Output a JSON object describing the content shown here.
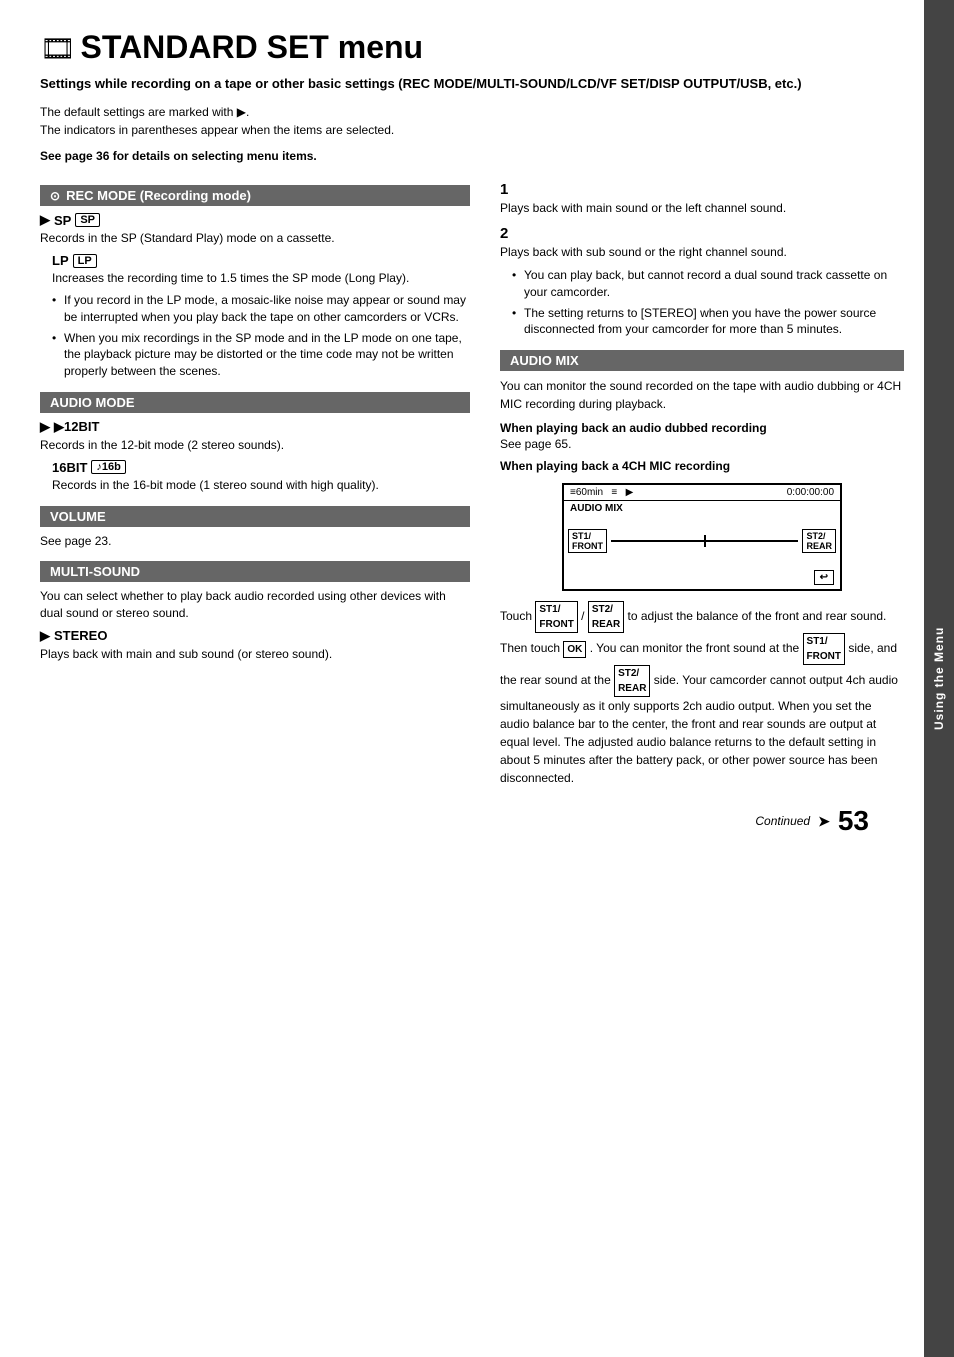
{
  "header": {
    "icon": "🎞",
    "title": "STANDARD SET menu",
    "subtitle": "Settings while recording on a tape or other basic settings (REC MODE/MULTI-SOUND/LCD/VF SET/DISP OUTPUT/USB, etc.)",
    "intro1": "The default settings are marked with ▶.",
    "intro2": "The indicators in parentheses appear when the items are selected.",
    "bold_link": "See page 36 for details on selecting menu items."
  },
  "left_column": {
    "rec_mode": {
      "header": "REC MODE (Recording mode)",
      "sp_label": "▶SP",
      "sp_badge": "SP",
      "sp_desc": "Records in the SP (Standard Play) mode on a cassette.",
      "lp_label": "LP",
      "lp_badge": "LP",
      "lp_desc": "Increases the recording time to 1.5 times the SP mode (Long Play).",
      "bullets": [
        "If you record in the LP mode, a mosaic-like noise may appear or sound may be interrupted when you play back the tape on other camcorders or VCRs.",
        "When you mix recordings in the SP mode and in the LP mode on one tape, the playback picture may be distorted or the time code may not be written properly between the scenes."
      ]
    },
    "audio_mode": {
      "header": "AUDIO MODE",
      "bit12_label": "▶12BIT",
      "bit12_desc": "Records in the 12-bit mode (2 stereo sounds).",
      "bit16_label": "16BIT",
      "bit16_badge": "♪16b",
      "bit16_desc": "Records in the 16-bit mode (1 stereo sound with high quality)."
    },
    "volume": {
      "header": "VOLUME",
      "desc": "See page 23."
    },
    "multi_sound": {
      "header": "MULTI-SOUND",
      "desc": "You can select whether to play back audio recorded using other devices with dual sound or stereo sound.",
      "stereo_label": "▶STEREO",
      "stereo_desc": "Plays back with main and sub sound (or stereo sound)."
    }
  },
  "right_column": {
    "item1": {
      "number": "1",
      "desc": "Plays back with main sound or the left channel sound."
    },
    "item2": {
      "number": "2",
      "desc": "Plays back with sub sound or the right channel sound."
    },
    "bullets": [
      "You can play back, but cannot record a dual sound track cassette on your camcorder.",
      "The setting returns to [STEREO] when you have the power source disconnected from your camcorder for more than 5 minutes."
    ],
    "audio_mix": {
      "header": "AUDIO MIX",
      "desc": "You can monitor the sound recorded on the tape with audio dubbing or 4CH MIC recording during playback.",
      "sub1_title": "When playing back an audio dubbed recording",
      "sub1_desc": "See page 65.",
      "sub2_title": "When playing back a 4CH MIC recording",
      "display": {
        "top_left": "≡60min  ≡  ▶",
        "top_right": "0:00:00:00",
        "label": "AUDIO MIX",
        "badge_left": "ST1/\nFRONT",
        "badge_right": "ST2/\nREAR"
      }
    },
    "touch_para": "Touch  ST1/FRONT / ST2/REAR  to adjust the balance of the front and rear sound. Then touch  OK . You can monitor the front sound at the  ST1/FRONT  side, and the rear sound at the  ST2/REAR  side. Your camcorder cannot output 4ch audio simultaneously as it only supports 2ch audio output. When you set the audio balance bar to the center, the front and rear sounds are output at equal level. The adjusted audio balance returns to the default setting in about 5 minutes after the battery pack, or other power source has been disconnected."
  },
  "sidebar": {
    "label": "Using the Menu"
  },
  "footer": {
    "continued": "Continued",
    "arrow": "➤",
    "page_number": "53"
  }
}
